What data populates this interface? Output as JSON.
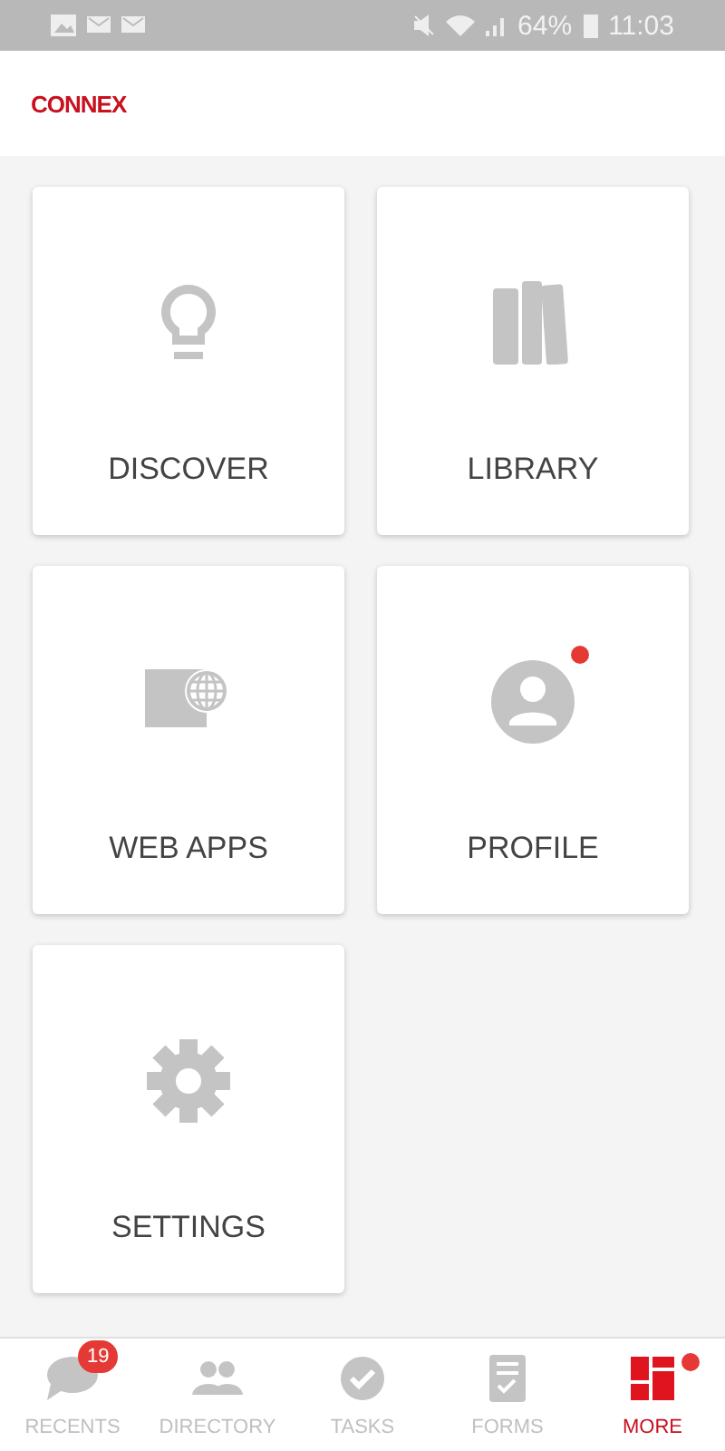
{
  "status_bar": {
    "battery": "64%",
    "time": "11:03"
  },
  "header": {
    "logo": "CONNEX"
  },
  "tiles": [
    {
      "label": "DISCOVER",
      "kind": "bulb",
      "dot": false
    },
    {
      "label": "LIBRARY",
      "kind": "books",
      "dot": false
    },
    {
      "label": "WEB APPS",
      "kind": "web",
      "dot": false
    },
    {
      "label": "PROFILE",
      "kind": "profile",
      "dot": true
    },
    {
      "label": "SETTINGS",
      "kind": "gear",
      "dot": false
    }
  ],
  "nav": [
    {
      "label": "RECENTS",
      "kind": "chat",
      "selected": false,
      "badge": "19",
      "dot": false
    },
    {
      "label": "DIRECTORY",
      "kind": "people",
      "selected": false,
      "dot": false
    },
    {
      "label": "TASKS",
      "kind": "check",
      "selected": false,
      "dot": false
    },
    {
      "label": "FORMS",
      "kind": "form",
      "selected": false,
      "dot": false
    },
    {
      "label": "MORE",
      "kind": "grid",
      "selected": true,
      "dot": true
    }
  ]
}
